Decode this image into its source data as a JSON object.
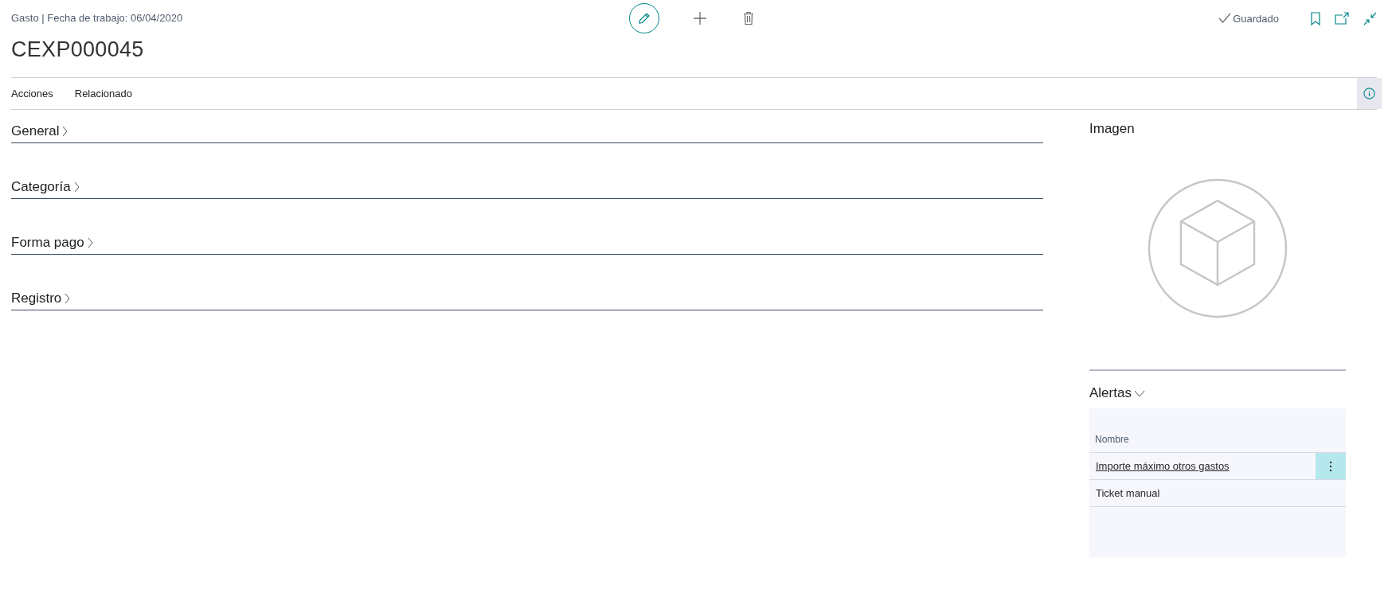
{
  "header": {
    "caption": "Gasto | Fecha de trabajo: 06/04/2020",
    "title": "CEXP000045",
    "status": "Guardado"
  },
  "action_bar": {
    "items": [
      "Acciones",
      "Relacionado"
    ]
  },
  "sections": [
    {
      "title": "General",
      "expanded": false
    },
    {
      "title": "Categoría",
      "expanded": false
    },
    {
      "title": "Forma pago",
      "expanded": false
    },
    {
      "title": "Registro",
      "expanded": false
    }
  ],
  "factbox": {
    "image": {
      "title": "Imagen"
    },
    "alerts": {
      "title": "Alertas",
      "expanded": true,
      "column": "Nombre",
      "rows": [
        {
          "name": "Importe máximo otros gastos",
          "selected": true
        },
        {
          "name": "Ticket manual",
          "selected": false
        }
      ]
    }
  }
}
